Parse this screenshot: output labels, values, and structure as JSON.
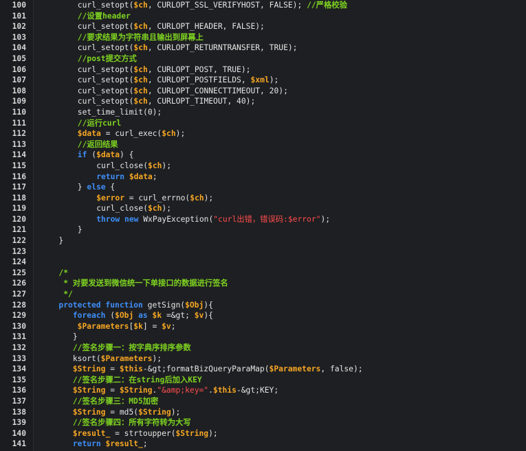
{
  "lines": [
    {
      "n": "100",
      "indent": 8,
      "tokens": [
        [
          "curl_setopt(",
          "plain"
        ],
        [
          "$ch",
          "var"
        ],
        [
          ", CURLOPT_SSL_VERIFYHOST, FALSE); ",
          "plain"
        ],
        [
          "//严格校验",
          "cm"
        ]
      ]
    },
    {
      "n": "101",
      "indent": 8,
      "tokens": [
        [
          "//设置header",
          "cm"
        ]
      ]
    },
    {
      "n": "102",
      "indent": 8,
      "tokens": [
        [
          "curl_setopt(",
          "plain"
        ],
        [
          "$ch",
          "var"
        ],
        [
          ", CURLOPT_HEADER, FALSE);",
          "plain"
        ]
      ]
    },
    {
      "n": "103",
      "indent": 8,
      "tokens": [
        [
          "//要求结果为字符串且输出到屏幕上",
          "cm"
        ]
      ]
    },
    {
      "n": "104",
      "indent": 8,
      "tokens": [
        [
          "curl_setopt(",
          "plain"
        ],
        [
          "$ch",
          "var"
        ],
        [
          ", CURLOPT_RETURNTRANSFER, TRUE);",
          "plain"
        ]
      ]
    },
    {
      "n": "105",
      "indent": 8,
      "tokens": [
        [
          "//post提交方式",
          "cm"
        ]
      ]
    },
    {
      "n": "106",
      "indent": 8,
      "tokens": [
        [
          "curl_setopt(",
          "plain"
        ],
        [
          "$ch",
          "var"
        ],
        [
          ", CURLOPT_POST, TRUE);",
          "plain"
        ]
      ]
    },
    {
      "n": "107",
      "indent": 8,
      "tokens": [
        [
          "curl_setopt(",
          "plain"
        ],
        [
          "$ch",
          "var"
        ],
        [
          ", CURLOPT_POSTFIELDS, ",
          "plain"
        ],
        [
          "$xml",
          "var"
        ],
        [
          ");",
          "plain"
        ]
      ]
    },
    {
      "n": "108",
      "indent": 8,
      "tokens": [
        [
          "curl_setopt(",
          "plain"
        ],
        [
          "$ch",
          "var"
        ],
        [
          ", CURLOPT_CONNECTTIMEOUT, 20);",
          "plain"
        ]
      ]
    },
    {
      "n": "109",
      "indent": 8,
      "tokens": [
        [
          "curl_setopt(",
          "plain"
        ],
        [
          "$ch",
          "var"
        ],
        [
          ", CURLOPT_TIMEOUT, 40);",
          "plain"
        ]
      ]
    },
    {
      "n": "110",
      "indent": 8,
      "tokens": [
        [
          "set_time_limit(0);",
          "plain"
        ]
      ]
    },
    {
      "n": "111",
      "indent": 8,
      "tokens": [
        [
          "//运行curl",
          "cm"
        ]
      ]
    },
    {
      "n": "112",
      "indent": 8,
      "tokens": [
        [
          "$data",
          "var"
        ],
        [
          " = curl_exec(",
          "plain"
        ],
        [
          "$ch",
          "var"
        ],
        [
          ");",
          "plain"
        ]
      ]
    },
    {
      "n": "113",
      "indent": 8,
      "tokens": [
        [
          "//返回结果",
          "cm"
        ]
      ]
    },
    {
      "n": "114",
      "indent": 8,
      "tokens": [
        [
          "if",
          "kw"
        ],
        [
          " (",
          "plain"
        ],
        [
          "$data",
          "var"
        ],
        [
          ") {",
          "plain"
        ]
      ]
    },
    {
      "n": "115",
      "indent": 12,
      "tokens": [
        [
          "curl_close(",
          "plain"
        ],
        [
          "$ch",
          "var"
        ],
        [
          ");",
          "plain"
        ]
      ]
    },
    {
      "n": "116",
      "indent": 12,
      "tokens": [
        [
          "return",
          "kw"
        ],
        [
          " ",
          "plain"
        ],
        [
          "$data",
          "var"
        ],
        [
          ";",
          "plain"
        ]
      ]
    },
    {
      "n": "117",
      "indent": 8,
      "tokens": [
        [
          "} ",
          "plain"
        ],
        [
          "else",
          "kw"
        ],
        [
          " {",
          "plain"
        ]
      ]
    },
    {
      "n": "118",
      "indent": 12,
      "tokens": [
        [
          "$error",
          "var"
        ],
        [
          " = curl_errno(",
          "plain"
        ],
        [
          "$ch",
          "var"
        ],
        [
          ");",
          "plain"
        ]
      ]
    },
    {
      "n": "119",
      "indent": 12,
      "tokens": [
        [
          "curl_close(",
          "plain"
        ],
        [
          "$ch",
          "var"
        ],
        [
          ");",
          "plain"
        ]
      ]
    },
    {
      "n": "120",
      "indent": 12,
      "tokens": [
        [
          "throw",
          "kw"
        ],
        [
          " ",
          "plain"
        ],
        [
          "new",
          "kw"
        ],
        [
          " WxPayException(",
          "plain"
        ],
        [
          "\"curl出错，错误码:$error\"",
          "str"
        ],
        [
          ");",
          "plain"
        ]
      ]
    },
    {
      "n": "121",
      "indent": 8,
      "tokens": [
        [
          "}",
          "plain"
        ]
      ]
    },
    {
      "n": "122",
      "indent": 4,
      "tokens": [
        [
          "}",
          "plain"
        ]
      ]
    },
    {
      "n": "123",
      "indent": 0,
      "tokens": []
    },
    {
      "n": "124",
      "indent": 0,
      "tokens": []
    },
    {
      "n": "125",
      "indent": 4,
      "tokens": [
        [
          "/*",
          "cm"
        ]
      ]
    },
    {
      "n": "126",
      "indent": 4,
      "tokens": [
        [
          " * 对要发送到微信统一下单接口的数据进行签名",
          "cm"
        ]
      ]
    },
    {
      "n": "127",
      "indent": 4,
      "tokens": [
        [
          " */",
          "cm"
        ]
      ]
    },
    {
      "n": "128",
      "indent": 4,
      "tokens": [
        [
          "protected",
          "kw"
        ],
        [
          " ",
          "plain"
        ],
        [
          "function",
          "kw"
        ],
        [
          " getSign(",
          "plain"
        ],
        [
          "$Obj",
          "var"
        ],
        [
          "){",
          "plain"
        ]
      ]
    },
    {
      "n": "129",
      "indent": 5,
      "tokens": [
        [
          "  ",
          "plain"
        ],
        [
          "foreach",
          "kw"
        ],
        [
          " (",
          "plain"
        ],
        [
          "$Obj",
          "var"
        ],
        [
          " ",
          "plain"
        ],
        [
          "as",
          "kw"
        ],
        [
          " ",
          "plain"
        ],
        [
          "$k",
          "var"
        ],
        [
          " =&gt; ",
          "plain"
        ],
        [
          "$v",
          "var"
        ],
        [
          "){",
          "plain"
        ]
      ]
    },
    {
      "n": "130",
      "indent": 5,
      "tokens": [
        [
          "   ",
          "plain"
        ],
        [
          "$Parameters",
          "var"
        ],
        [
          "[",
          "plain"
        ],
        [
          "$k",
          "var"
        ],
        [
          "] = ",
          "plain"
        ],
        [
          "$v",
          "var"
        ],
        [
          ";",
          "plain"
        ]
      ]
    },
    {
      "n": "131",
      "indent": 5,
      "tokens": [
        [
          "  }",
          "plain"
        ]
      ]
    },
    {
      "n": "132",
      "indent": 5,
      "tokens": [
        [
          "  ",
          "plain"
        ],
        [
          "//签名步骤一：按字典序排序参数",
          "cm"
        ]
      ]
    },
    {
      "n": "133",
      "indent": 5,
      "tokens": [
        [
          "  ksort(",
          "plain"
        ],
        [
          "$Parameters",
          "var"
        ],
        [
          ");",
          "plain"
        ]
      ]
    },
    {
      "n": "134",
      "indent": 5,
      "tokens": [
        [
          "  ",
          "plain"
        ],
        [
          "$String",
          "var"
        ],
        [
          " = ",
          "plain"
        ],
        [
          "$this",
          "var"
        ],
        [
          "-&gt;formatBizQueryParaMap(",
          "plain"
        ],
        [
          "$Parameters",
          "var"
        ],
        [
          ", false);",
          "plain"
        ]
      ]
    },
    {
      "n": "135",
      "indent": 5,
      "tokens": [
        [
          "  ",
          "plain"
        ],
        [
          "//签名步骤二：在string后加入KEY",
          "cm"
        ]
      ]
    },
    {
      "n": "136",
      "indent": 5,
      "tokens": [
        [
          "  ",
          "plain"
        ],
        [
          "$String",
          "var"
        ],
        [
          " = ",
          "plain"
        ],
        [
          "$String",
          "var"
        ],
        [
          ".",
          "plain"
        ],
        [
          "\"&amp;key=\"",
          "str"
        ],
        [
          ".",
          "plain"
        ],
        [
          "$this",
          "var"
        ],
        [
          "-&gt;KEY;",
          "plain"
        ]
      ]
    },
    {
      "n": "137",
      "indent": 5,
      "tokens": [
        [
          "  ",
          "plain"
        ],
        [
          "//签名步骤三：MD5加密",
          "cm"
        ]
      ]
    },
    {
      "n": "138",
      "indent": 5,
      "tokens": [
        [
          "  ",
          "plain"
        ],
        [
          "$String",
          "var"
        ],
        [
          " = md5(",
          "plain"
        ],
        [
          "$String",
          "var"
        ],
        [
          ");",
          "plain"
        ]
      ]
    },
    {
      "n": "139",
      "indent": 5,
      "tokens": [
        [
          "  ",
          "plain"
        ],
        [
          "//签名步骤四：所有字符转为大写",
          "cm"
        ]
      ]
    },
    {
      "n": "140",
      "indent": 5,
      "tokens": [
        [
          "  ",
          "plain"
        ],
        [
          "$result_",
          "var"
        ],
        [
          " = strtoupper(",
          "plain"
        ],
        [
          "$String",
          "var"
        ],
        [
          ");",
          "plain"
        ]
      ]
    },
    {
      "n": "141",
      "indent": 5,
      "tokens": [
        [
          "  ",
          "plain"
        ],
        [
          "return",
          "kw"
        ],
        [
          " ",
          "plain"
        ],
        [
          "$result_",
          "var"
        ],
        [
          ";",
          "plain"
        ]
      ]
    }
  ]
}
